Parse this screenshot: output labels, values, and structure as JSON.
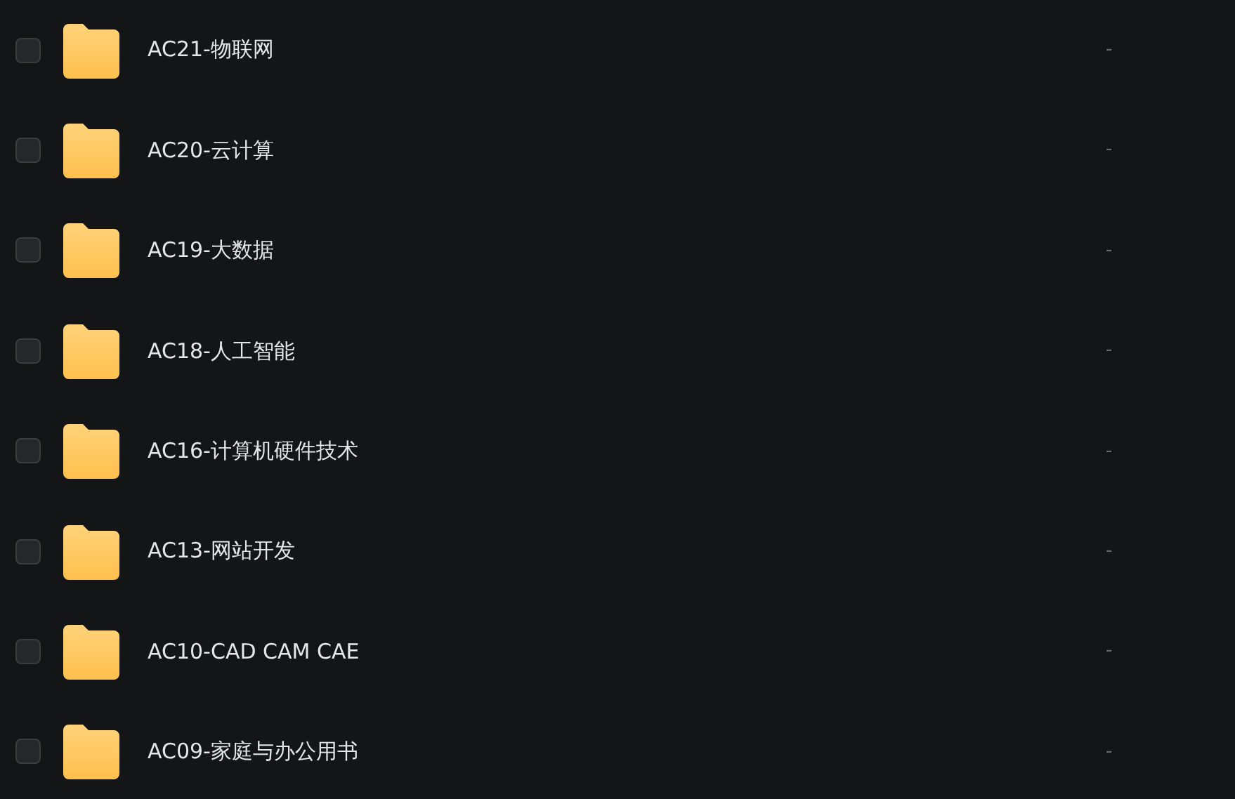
{
  "files": [
    {
      "name": "AC21-物联网",
      "checked": false,
      "size": "-"
    },
    {
      "name": "AC20-云计算",
      "checked": false,
      "size": "-"
    },
    {
      "name": "AC19-大数据",
      "checked": false,
      "size": "-"
    },
    {
      "name": "AC18-人工智能",
      "checked": false,
      "size": "-"
    },
    {
      "name": "AC16-计算机硬件技术",
      "checked": false,
      "size": "-"
    },
    {
      "name": "AC13-网站开发",
      "checked": false,
      "size": "-"
    },
    {
      "name": "AC10-CAD CAM CAE",
      "checked": false,
      "size": "-"
    },
    {
      "name": "AC09-家庭与办公用书",
      "checked": false,
      "size": "-"
    }
  ]
}
